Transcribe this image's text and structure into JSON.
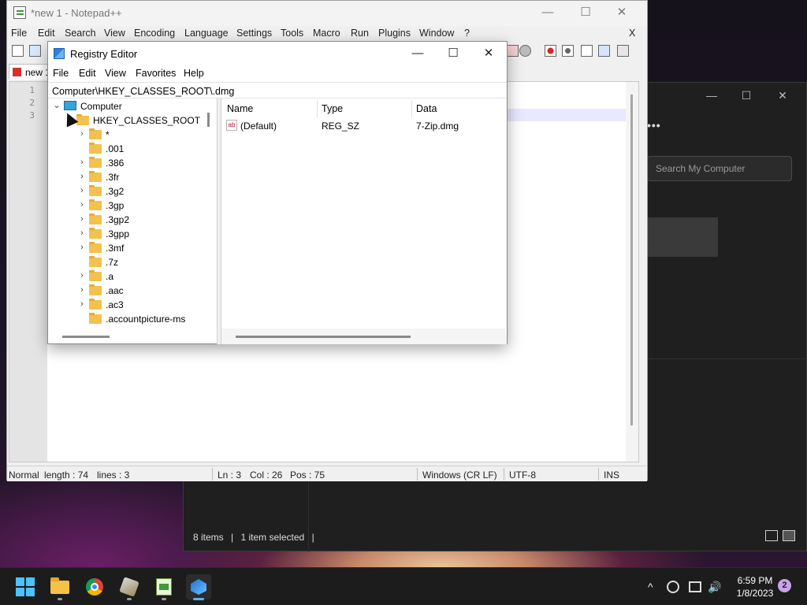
{
  "explorer": {
    "search_placeholder": "Search My Computer",
    "items_count": "8 items",
    "selected": "1 item selected",
    "min": "—",
    "max": "☐",
    "close": "✕",
    "more": "•••"
  },
  "notepad": {
    "title": "*new 1 - Notepad++",
    "menu": [
      "File",
      "Edit",
      "Search",
      "View",
      "Encoding",
      "Language",
      "Settings",
      "Tools",
      "Macro",
      "Run",
      "Plugins",
      "Window",
      "?"
    ],
    "close_doc": "X",
    "tab_label": "new 1",
    "line_numbers": [
      "1",
      "2",
      "3"
    ],
    "status": {
      "mode": "Normal",
      "length": "length : 74",
      "lines": "lines : 3",
      "ln": "Ln : 3",
      "col": "Col : 26",
      "pos": "Pos : 75",
      "eol": "Windows (CR LF)",
      "encoding": "UTF-8",
      "ins": "INS"
    },
    "min": "—",
    "max": "☐",
    "close": "✕"
  },
  "registry": {
    "title": "Registry Editor",
    "menu": [
      "File",
      "Edit",
      "View",
      "Favorites",
      "Help"
    ],
    "address": "Computer\\HKEY_CLASSES_ROOT\\.dmg",
    "tree": {
      "root": "Computer",
      "hive": "HKEY_CLASSES_ROOT",
      "keys": [
        "*",
        ".001",
        ".386",
        ".3fr",
        ".3g2",
        ".3gp",
        ".3gp2",
        ".3gpp",
        ".3mf",
        ".7z",
        ".a",
        ".aac",
        ".ac3",
        ".accountpicture-ms"
      ]
    },
    "columns": [
      "Name",
      "Type",
      "Data"
    ],
    "values": [
      {
        "name": "(Default)",
        "type": "REG_SZ",
        "data": "7-Zip.dmg"
      }
    ],
    "value_icon_text": "ab",
    "min": "—",
    "max": "☐",
    "close": "✕"
  },
  "taskbar": {
    "time": "6:59 PM",
    "date": "1/8/2023",
    "notification_count": "2",
    "tray": {
      "chevron": "^",
      "speaker": "🔊"
    }
  }
}
